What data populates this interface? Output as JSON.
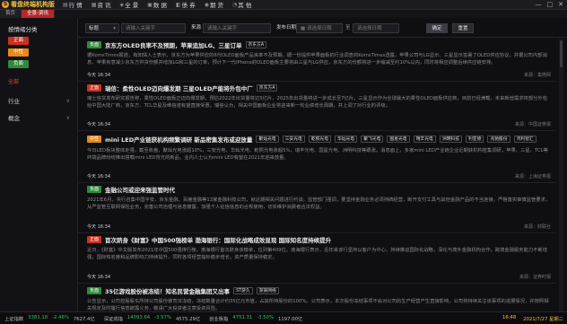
{
  "app": {
    "logo_mark": "S",
    "logo_text": "看盘终端机构版",
    "menu": [
      {
        "icon": "▤",
        "label": "行 情"
      },
      {
        "icon": "▦",
        "label": "资 讯"
      },
      {
        "icon": "◈",
        "label": "全 景"
      },
      {
        "icon": "▣",
        "label": "数 据"
      },
      {
        "icon": "◧",
        "label": "债 券"
      },
      {
        "icon": "◉",
        "label": "期 货"
      },
      {
        "icon": "◔",
        "label": "其 他"
      }
    ],
    "window_controls": {
      "minimize": "—",
      "maximize": "□",
      "close": "✕"
    }
  },
  "tabs": [
    {
      "label": "首页",
      "active": false
    },
    {
      "label": "全景-资讯",
      "active": true
    }
  ],
  "sidebar": {
    "title": "按情绪分类",
    "categories": [
      {
        "label": "正面",
        "color": "#c8311f"
      },
      {
        "label": "中性",
        "color": "#e58a1c"
      },
      {
        "label": "负面",
        "color": "#2f8a3a"
      }
    ],
    "all_label": "全部",
    "groups": [
      {
        "label": "行业",
        "chevron": "∨"
      },
      {
        "label": "概念",
        "chevron": "∨"
      }
    ]
  },
  "filter": {
    "scope_value": "标题",
    "keyword_placeholder": "请输入关键字",
    "source_label": "来源",
    "source_placeholder": "请输入关键字",
    "date_label": "发布日期",
    "start_placeholder": "请选择日期",
    "date_sep": "至",
    "end_placeholder": "请选择日期",
    "confirm_label": "确定",
    "reset_label": "重置"
  },
  "news": [
    {
      "sentiment": "负面",
      "sentiment_class": "g",
      "title": "京东方OLED良率不及预期，苹果追加LG、三星订单",
      "stocks": [
        "京东方A"
      ],
      "body": "据KomsTimes报道，有知情人士表示，京东方为苹果供应的6代OLED面板产品良率不及预期。据一份提供苹果面板的行业调查的KomsTimes透露，苹果公司与LG显示、三星显示签署了OLED供应协议，并据公司内部消息，苹果有意减少京东方供货份额并增加LG和三星的订单，预计下一代iPhone的OLED面板主要将由三星与LG供应，京东方的份额将进一步缩减至约10%以内，同时将相应调整后续供应链安排。",
      "time": "今天 16:34",
      "source": "来源：集微网"
    },
    {
      "sentiment": "正面",
      "sentiment_class": "r",
      "title": "瑞信：柔性OLED迈向爆发期 三星OLED产能将外包中厂",
      "stocks": [
        "京东方A"
      ],
      "body": "瑞士信贷发布研究报告称，柔性OLED面板正迈向爆发期，预估2022年出货量将达5亿片，2025年出货量将进一步成长至7亿片。三星显示作为全球最大的柔性OLED面板供应商，目前已经满载，未来新增需求将部分外包给中国大陆厂商，京东方、TCL华星及维信诺有望直接受惠。瑞信认为，相关中国面板企业将迎来新一轮业绩增长周期，并上调了对行业的评级。",
      "time": "今天 16:34",
      "source": "来源：中国证券报"
    },
    {
      "sentiment": "中性",
      "sentiment_class": "o",
      "title": "mini LED产业链获机构频繁调研 新品密集发布或迎放量",
      "stocks": [
        "聚灿光电",
        "三安光电",
        "乾照光电",
        "华灿光电",
        "聚飞光电",
        "国星光电",
        "瑞丰光电",
        "洲明科技",
        "利亚德",
        "兆驰股份",
        "鸿利智汇"
      ],
      "body": "今日LED板块整体走强，截至收盘，聚灿光电涨超10%，三安光电、华灿光电、乾照光电涨超5%，瑞丰光电、国星光电、洲明科技等跟涨。消息面上，多家mini LED产业链企业近期获机构密集调研，苹果、三星、TCL等终端品牌纷纷推出搭载mini LED背光的新品，业内人士认为mini LED有望在2021年迎来放量。",
      "time": "今天 16:34",
      "source": "来源：上海证券报"
    },
    {
      "sentiment": "负面",
      "sentiment_class": "g",
      "title": "金融公司或迎来强监管时代",
      "stocks": [],
      "body": "2021年6月，央行召集中国平安、京东金融、百度金融等13家金融科技公司，就近期相关问题进行约谈。监管部门强调，要坚持金融业务必须持牌经营，断开支付工具与其他金融产品的不当连接，严格落实审慎监管要求，从严监管互联网保险业务，完善公司治理与信息披露，加强个人征信信息的合规使用，切实维护消费者合法权益。",
      "time": "今天 16:34",
      "source": "来源：财联社"
    },
    {
      "sentiment": "正面",
      "sentiment_class": "r",
      "title": "首次跻身《财富》中国500强榜单 渤海银行：国际化战略成效显现 国际知名度持续提升",
      "stocks": [],
      "body": "近日，《财富》中文版发布2021年中国500强排行榜，渤海银行首次跻身该榜单，位列第409位。渤海银行表示，近年来该行坚持以客户为中心，持续推进国际化战略，深化与境外金融机构合作，跨境金融服务能力不断增强，国际知名度和品牌影响力持续提升，同时各项经营指标稳步增长，资产质量保持稳定。",
      "time": "今天 16:34",
      "source": "来源：证券时报"
    },
    {
      "sentiment": "负面",
      "sentiment_class": "g",
      "title": "35亿游戏股份被冻结！知名民营金融集团又出事",
      "stocks": [
        "ST游久",
        "游族网络"
      ],
      "body": "公告显示，公司控股股东所持公司股份被司法冻结，冻结数量合计约35亿元市值，占其所持股份的100%。公司表示，本次股份冻结事项不会对公司的生产经营产生直接影响，公司将持续关注该事项的进展情况，并按照相关规定及时履行信息披露义务，敬请广大投资者注意投资风险。",
      "time": "今天 16:34",
      "source": "来源：中国基金报"
    }
  ],
  "status": {
    "indices": [
      {
        "name": "上证指数",
        "value": "3381.18",
        "change": "-2.46%",
        "dir": "dn",
        "vol": "7627.4亿"
      },
      {
        "name": "深证成指",
        "value": "14093.64",
        "change": "-3.57%",
        "dir": "dn",
        "vol": "4575.29亿"
      },
      {
        "name": "创业板指",
        "value": "4751.31",
        "change": "-3.50%",
        "dir": "dn",
        "vol": "1197.00亿"
      }
    ],
    "clock": "16:48",
    "date": "2021/7/27 星期二"
  }
}
